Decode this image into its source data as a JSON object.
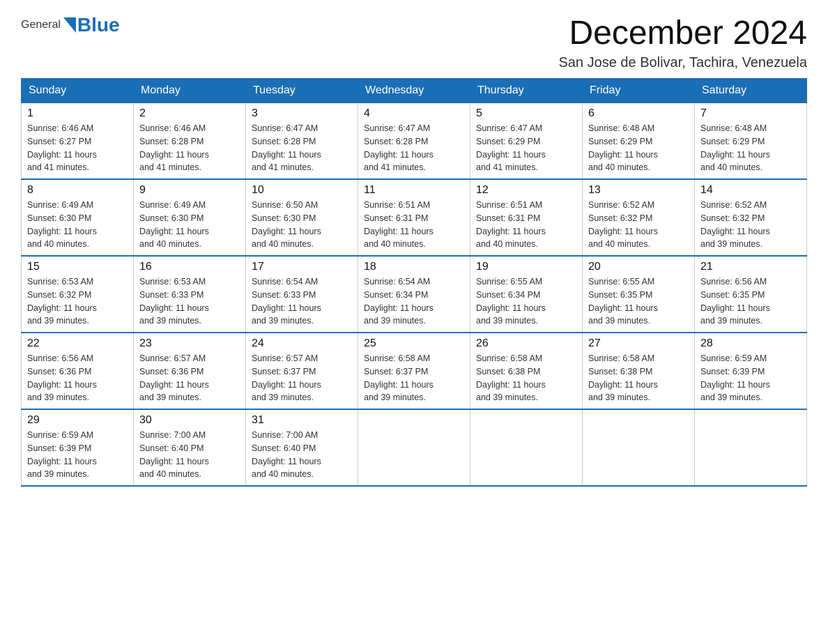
{
  "header": {
    "logo_general": "General",
    "logo_blue": "Blue",
    "title": "December 2024",
    "location": "San Jose de Bolivar, Tachira, Venezuela"
  },
  "weekdays": [
    "Sunday",
    "Monday",
    "Tuesday",
    "Wednesday",
    "Thursday",
    "Friday",
    "Saturday"
  ],
  "weeks": [
    [
      {
        "day": "1",
        "sunrise": "6:46 AM",
        "sunset": "6:27 PM",
        "daylight": "11 hours and 41 minutes."
      },
      {
        "day": "2",
        "sunrise": "6:46 AM",
        "sunset": "6:28 PM",
        "daylight": "11 hours and 41 minutes."
      },
      {
        "day": "3",
        "sunrise": "6:47 AM",
        "sunset": "6:28 PM",
        "daylight": "11 hours and 41 minutes."
      },
      {
        "day": "4",
        "sunrise": "6:47 AM",
        "sunset": "6:28 PM",
        "daylight": "11 hours and 41 minutes."
      },
      {
        "day": "5",
        "sunrise": "6:47 AM",
        "sunset": "6:29 PM",
        "daylight": "11 hours and 41 minutes."
      },
      {
        "day": "6",
        "sunrise": "6:48 AM",
        "sunset": "6:29 PM",
        "daylight": "11 hours and 40 minutes."
      },
      {
        "day": "7",
        "sunrise": "6:48 AM",
        "sunset": "6:29 PM",
        "daylight": "11 hours and 40 minutes."
      }
    ],
    [
      {
        "day": "8",
        "sunrise": "6:49 AM",
        "sunset": "6:30 PM",
        "daylight": "11 hours and 40 minutes."
      },
      {
        "day": "9",
        "sunrise": "6:49 AM",
        "sunset": "6:30 PM",
        "daylight": "11 hours and 40 minutes."
      },
      {
        "day": "10",
        "sunrise": "6:50 AM",
        "sunset": "6:30 PM",
        "daylight": "11 hours and 40 minutes."
      },
      {
        "day": "11",
        "sunrise": "6:51 AM",
        "sunset": "6:31 PM",
        "daylight": "11 hours and 40 minutes."
      },
      {
        "day": "12",
        "sunrise": "6:51 AM",
        "sunset": "6:31 PM",
        "daylight": "11 hours and 40 minutes."
      },
      {
        "day": "13",
        "sunrise": "6:52 AM",
        "sunset": "6:32 PM",
        "daylight": "11 hours and 40 minutes."
      },
      {
        "day": "14",
        "sunrise": "6:52 AM",
        "sunset": "6:32 PM",
        "daylight": "11 hours and 39 minutes."
      }
    ],
    [
      {
        "day": "15",
        "sunrise": "6:53 AM",
        "sunset": "6:32 PM",
        "daylight": "11 hours and 39 minutes."
      },
      {
        "day": "16",
        "sunrise": "6:53 AM",
        "sunset": "6:33 PM",
        "daylight": "11 hours and 39 minutes."
      },
      {
        "day": "17",
        "sunrise": "6:54 AM",
        "sunset": "6:33 PM",
        "daylight": "11 hours and 39 minutes."
      },
      {
        "day": "18",
        "sunrise": "6:54 AM",
        "sunset": "6:34 PM",
        "daylight": "11 hours and 39 minutes."
      },
      {
        "day": "19",
        "sunrise": "6:55 AM",
        "sunset": "6:34 PM",
        "daylight": "11 hours and 39 minutes."
      },
      {
        "day": "20",
        "sunrise": "6:55 AM",
        "sunset": "6:35 PM",
        "daylight": "11 hours and 39 minutes."
      },
      {
        "day": "21",
        "sunrise": "6:56 AM",
        "sunset": "6:35 PM",
        "daylight": "11 hours and 39 minutes."
      }
    ],
    [
      {
        "day": "22",
        "sunrise": "6:56 AM",
        "sunset": "6:36 PM",
        "daylight": "11 hours and 39 minutes."
      },
      {
        "day": "23",
        "sunrise": "6:57 AM",
        "sunset": "6:36 PM",
        "daylight": "11 hours and 39 minutes."
      },
      {
        "day": "24",
        "sunrise": "6:57 AM",
        "sunset": "6:37 PM",
        "daylight": "11 hours and 39 minutes."
      },
      {
        "day": "25",
        "sunrise": "6:58 AM",
        "sunset": "6:37 PM",
        "daylight": "11 hours and 39 minutes."
      },
      {
        "day": "26",
        "sunrise": "6:58 AM",
        "sunset": "6:38 PM",
        "daylight": "11 hours and 39 minutes."
      },
      {
        "day": "27",
        "sunrise": "6:58 AM",
        "sunset": "6:38 PM",
        "daylight": "11 hours and 39 minutes."
      },
      {
        "day": "28",
        "sunrise": "6:59 AM",
        "sunset": "6:39 PM",
        "daylight": "11 hours and 39 minutes."
      }
    ],
    [
      {
        "day": "29",
        "sunrise": "6:59 AM",
        "sunset": "6:39 PM",
        "daylight": "11 hours and 39 minutes."
      },
      {
        "day": "30",
        "sunrise": "7:00 AM",
        "sunset": "6:40 PM",
        "daylight": "11 hours and 40 minutes."
      },
      {
        "day": "31",
        "sunrise": "7:00 AM",
        "sunset": "6:40 PM",
        "daylight": "11 hours and 40 minutes."
      },
      null,
      null,
      null,
      null
    ]
  ],
  "labels": {
    "sunrise": "Sunrise:",
    "sunset": "Sunset:",
    "daylight": "Daylight:"
  }
}
